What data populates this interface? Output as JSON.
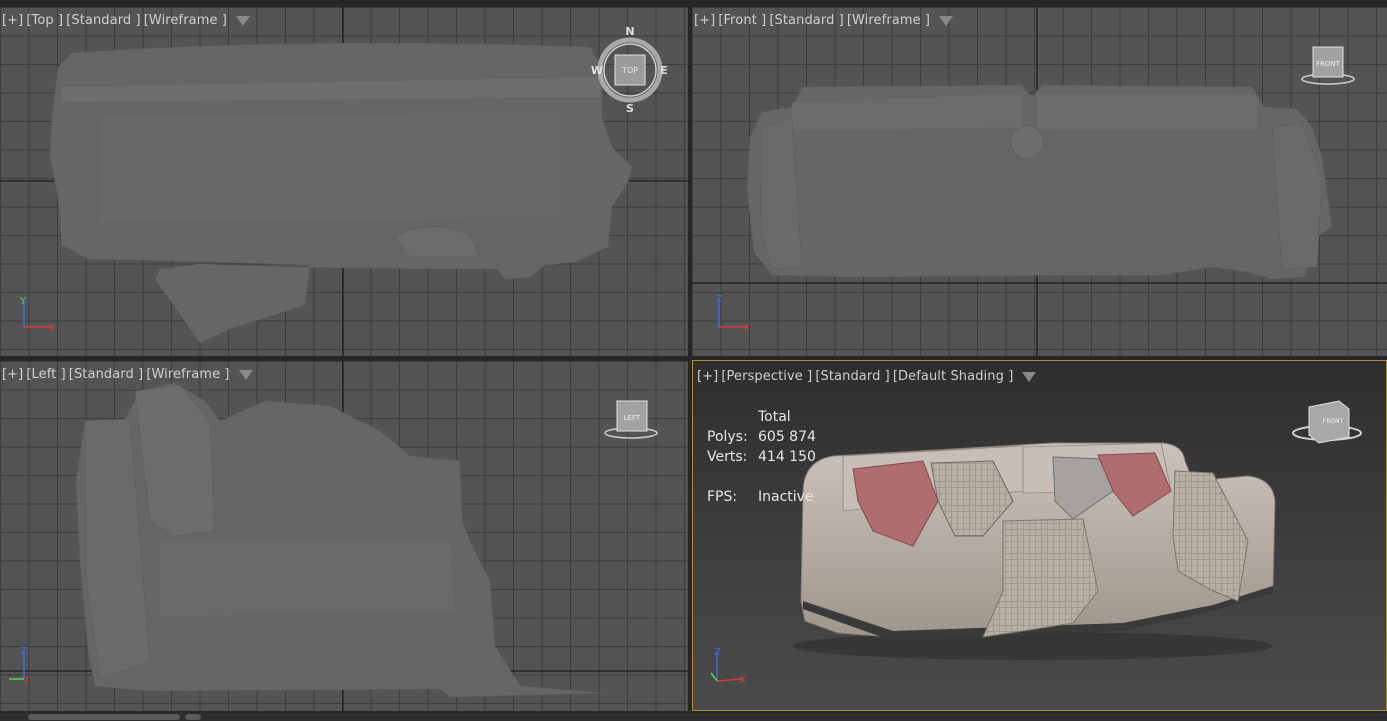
{
  "viewports": {
    "top": {
      "menu": "[+]",
      "view": "[Top ]",
      "shading": "[Standard ]",
      "mode": "[Wireframe ]",
      "cube_label": "TOP",
      "compass": {
        "n": "N",
        "s": "S",
        "e": "E",
        "w": "W"
      },
      "axes": {
        "v": "Y",
        "h": "X"
      }
    },
    "front": {
      "menu": "[+]",
      "view": "[Front ]",
      "shading": "[Standard ]",
      "mode": "[Wireframe ]",
      "cube_label": "FRONT",
      "axes": {
        "v": "Z",
        "h": "X"
      }
    },
    "left": {
      "menu": "[+]",
      "view": "[Left ]",
      "shading": "[Standard ]",
      "mode": "[Wireframe ]",
      "cube_label": "LEFT",
      "axes": {
        "v": "Z",
        "h": "Y"
      }
    },
    "perspective": {
      "menu": "[+]",
      "view": "[Perspective ]",
      "shading": "[Standard ]",
      "mode": "[Default Shading ]",
      "cube_label": "FRONT",
      "axes": {
        "v": "Z",
        "h": "X"
      },
      "stats": {
        "header": "Total",
        "polys_label": "Polys:",
        "polys_value": "605 874",
        "verts_label": "Verts:",
        "verts_value": "414 150",
        "fps_label": "FPS:",
        "fps_value": "Inactive"
      }
    }
  },
  "colors": {
    "viewport_bg": "#545454",
    "grid_line": "#3d3d3d",
    "mesh_fill": "#666666",
    "active_border": "#b08c3a",
    "perspective_bg_top": "#2f2f2f",
    "perspective_bg_bottom": "#4a4a4a"
  }
}
